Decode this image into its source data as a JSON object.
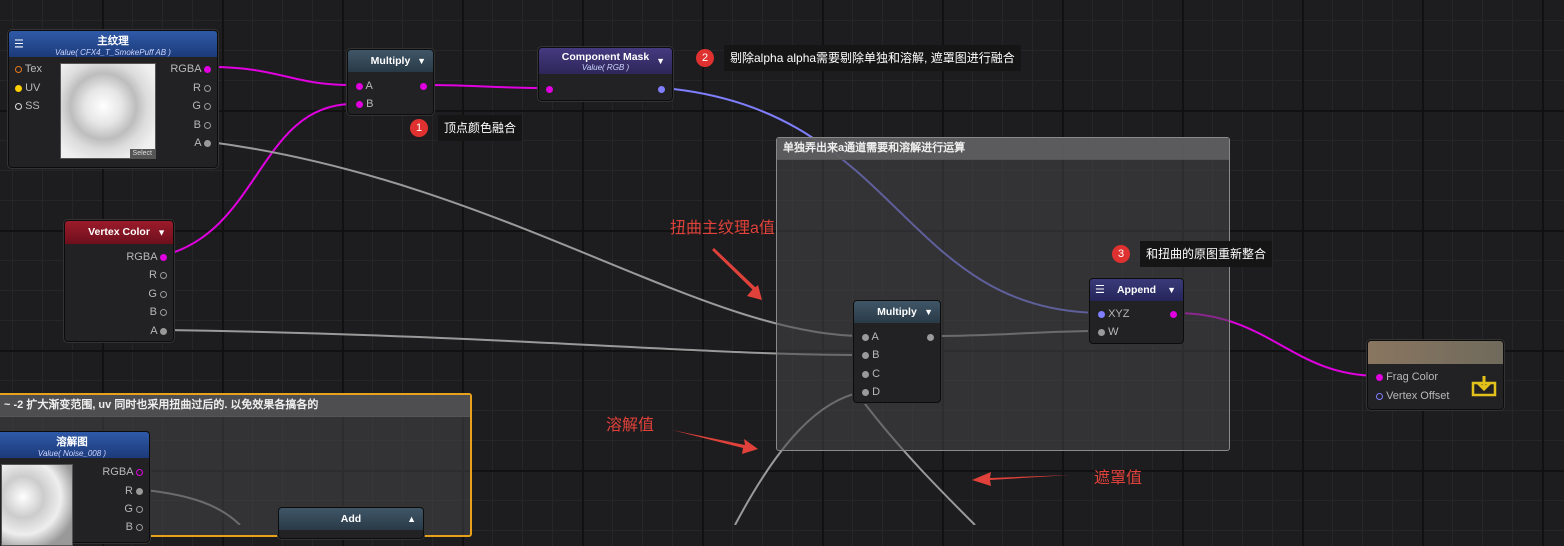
{
  "groups": [
    {
      "title": "单独弄出来a通道需要和溶解进行运算"
    },
    {
      "title": "~ -2 扩大渐变范围, uv 同时也采用扭曲过后的. 以免效果各搞各的"
    }
  ],
  "nodes": {
    "main_tex": {
      "title": "主纹理",
      "subtitle": "Value( CFX4_T_SmokePuff AB )",
      "inputs": [
        "Tex",
        "UV",
        "SS"
      ],
      "outputs": [
        "RGBA",
        "R",
        "G",
        "B",
        "A"
      ],
      "select_label": "Select"
    },
    "multiply_top": {
      "title": "Multiply",
      "inputs": [
        "A",
        "B"
      ]
    },
    "component_mask": {
      "title": "Component Mask",
      "subtitle": "Value( RGB )"
    },
    "vertex_color": {
      "title": "Vertex Color",
      "outputs": [
        "RGBA",
        "R",
        "G",
        "B",
        "A"
      ]
    },
    "multiply_mid": {
      "title": "Multiply",
      "inputs": [
        "A",
        "B",
        "C",
        "D"
      ]
    },
    "append": {
      "title": "Append",
      "inputs": [
        "XYZ",
        "W"
      ]
    },
    "output": {
      "inputs": [
        "Frag Color",
        "Vertex Offset"
      ]
    },
    "dissolve": {
      "title": "溶解图",
      "subtitle": "Value( Noise_008 )",
      "outputs": [
        "RGBA",
        "R",
        "G",
        "B"
      ]
    },
    "add": {
      "title": "Add"
    }
  },
  "annotations": [
    {
      "number": "1",
      "text": "顶点颜色融合"
    },
    {
      "number": "2",
      "text": "剔除alpha alpha需要剔除单独和溶解, 遮罩图进行融合"
    },
    {
      "number": "3",
      "text": "和扭曲的原图重新整合"
    }
  ],
  "red_labels": [
    "扭曲主纹理a值",
    "溶解值",
    "遮罩值"
  ],
  "icons": {
    "menu": "hamburger-icon",
    "dropdown": "triangle-down-icon",
    "collapse": "triangle-up-icon",
    "output": "download-icon"
  },
  "colors": {
    "magenta": "#e000e0",
    "purple": "#7f7fff",
    "gray": "#9a9a9a",
    "yellow": "#ffd000",
    "orange": "#e7a11a",
    "annotation_red": "#e03131"
  }
}
